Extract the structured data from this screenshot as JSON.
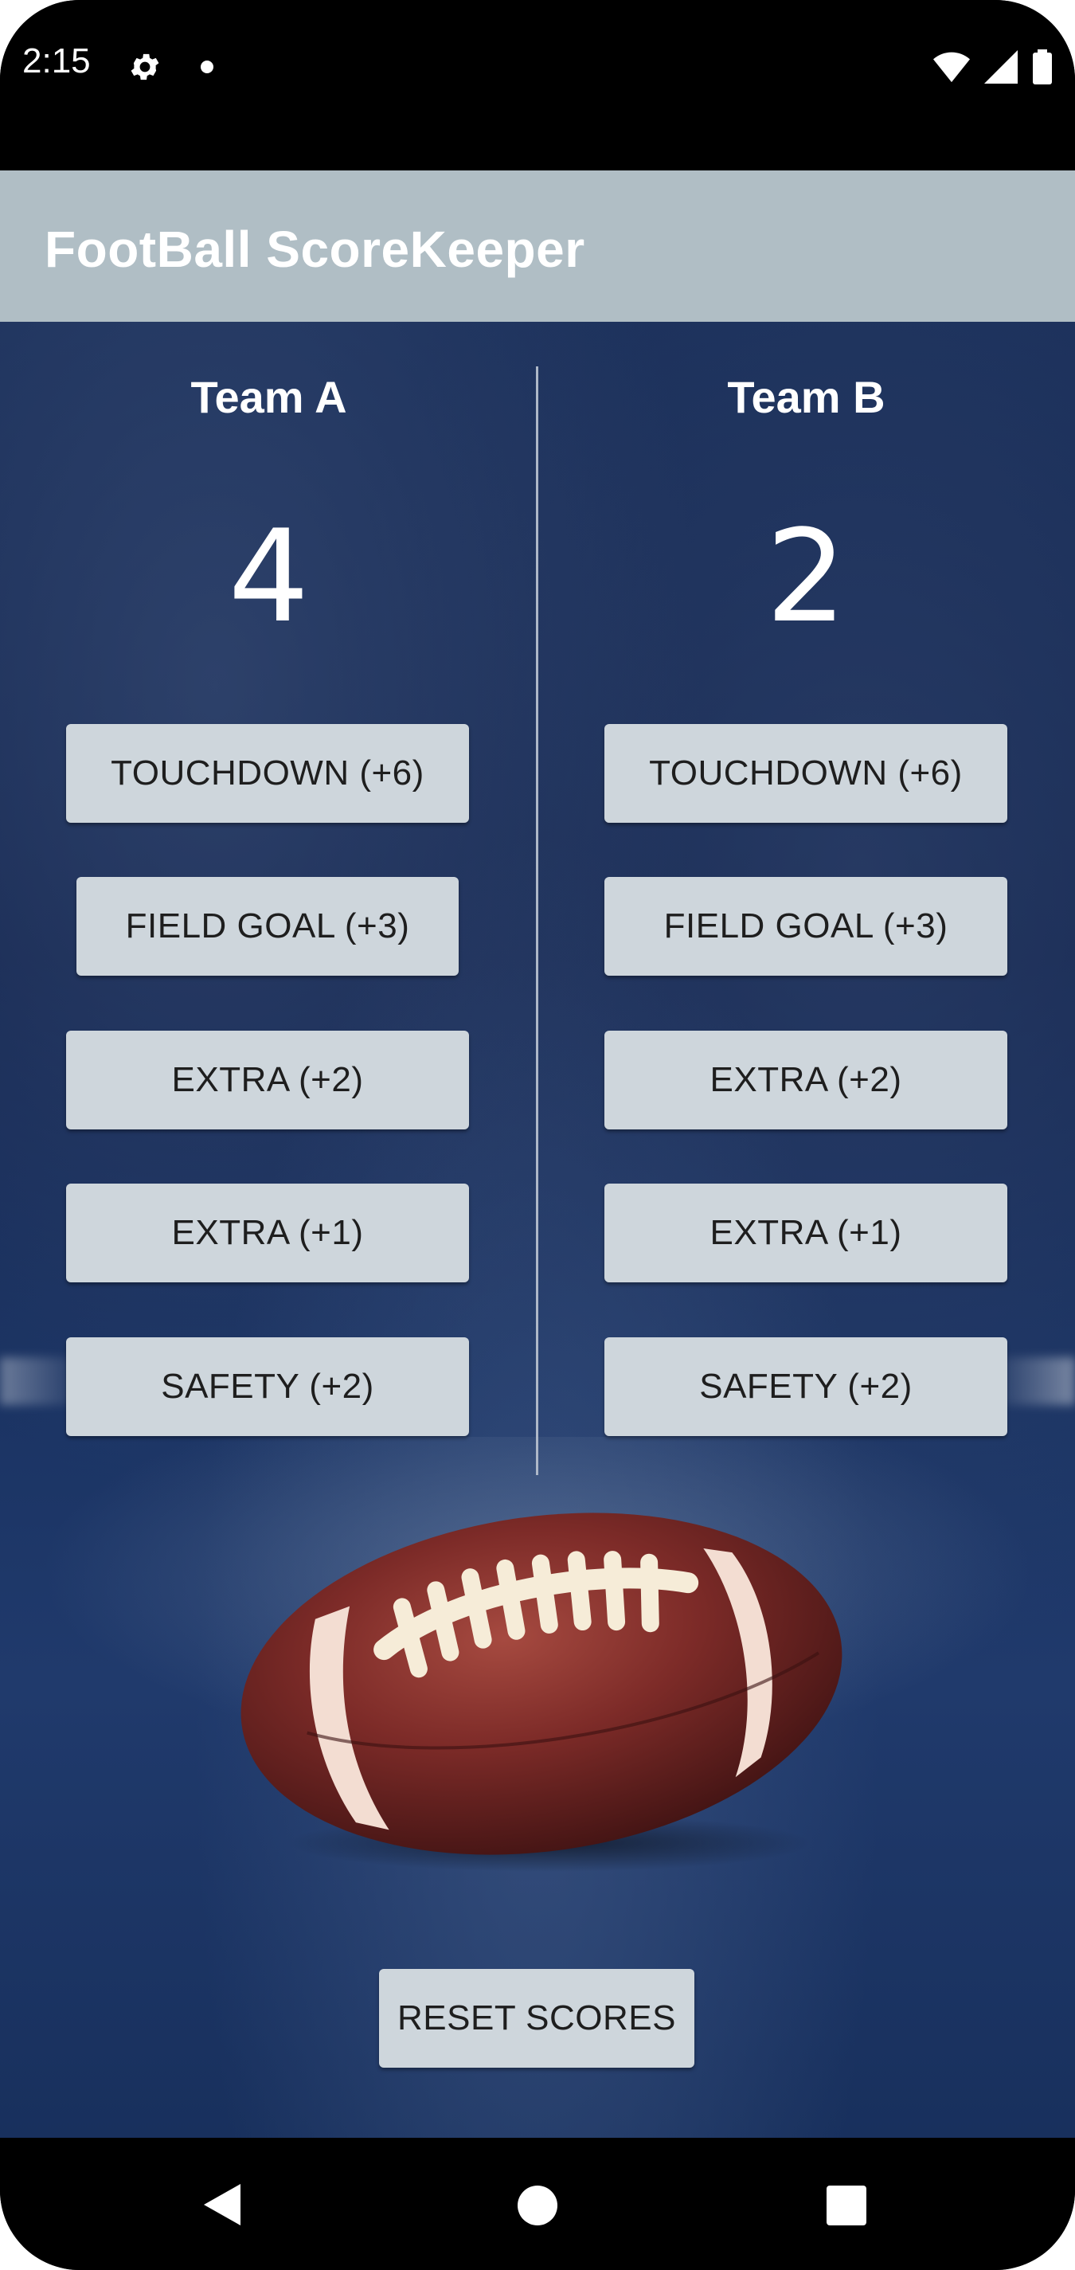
{
  "status_bar": {
    "time": "2:15",
    "icons": [
      "settings-gear-icon",
      "notification-dot-icon",
      "wifi-icon",
      "signal-icon",
      "battery-icon"
    ]
  },
  "app_bar": {
    "title": "FootBall ScoreKeeper",
    "color": "#b0bec5"
  },
  "team_a": {
    "name": "Team A",
    "score": "4",
    "buttons": [
      {
        "label": "TOUCHDOWN (+6)"
      },
      {
        "label": "FIELD GOAL (+3)"
      },
      {
        "label": "EXTRA (+2)"
      },
      {
        "label": "EXTRA (+1)"
      },
      {
        "label": "SAFETY (+2)"
      }
    ]
  },
  "team_b": {
    "name": "Team B",
    "score": "2",
    "buttons": [
      {
        "label": "TOUCHDOWN (+6)"
      },
      {
        "label": "FIELD GOAL (+3)"
      },
      {
        "label": "EXTRA (+2)"
      },
      {
        "label": "EXTRA (+1)"
      },
      {
        "label": "SAFETY (+2)"
      }
    ]
  },
  "reset_button": {
    "label": "RESET SCORES"
  },
  "nav_bar": {
    "icons": [
      "back-icon",
      "home-icon",
      "recents-icon"
    ]
  },
  "colors": {
    "button_bg": "#ced6dc",
    "background_navy": "#1a2f5a",
    "football_leather": "#7a2a2a"
  }
}
